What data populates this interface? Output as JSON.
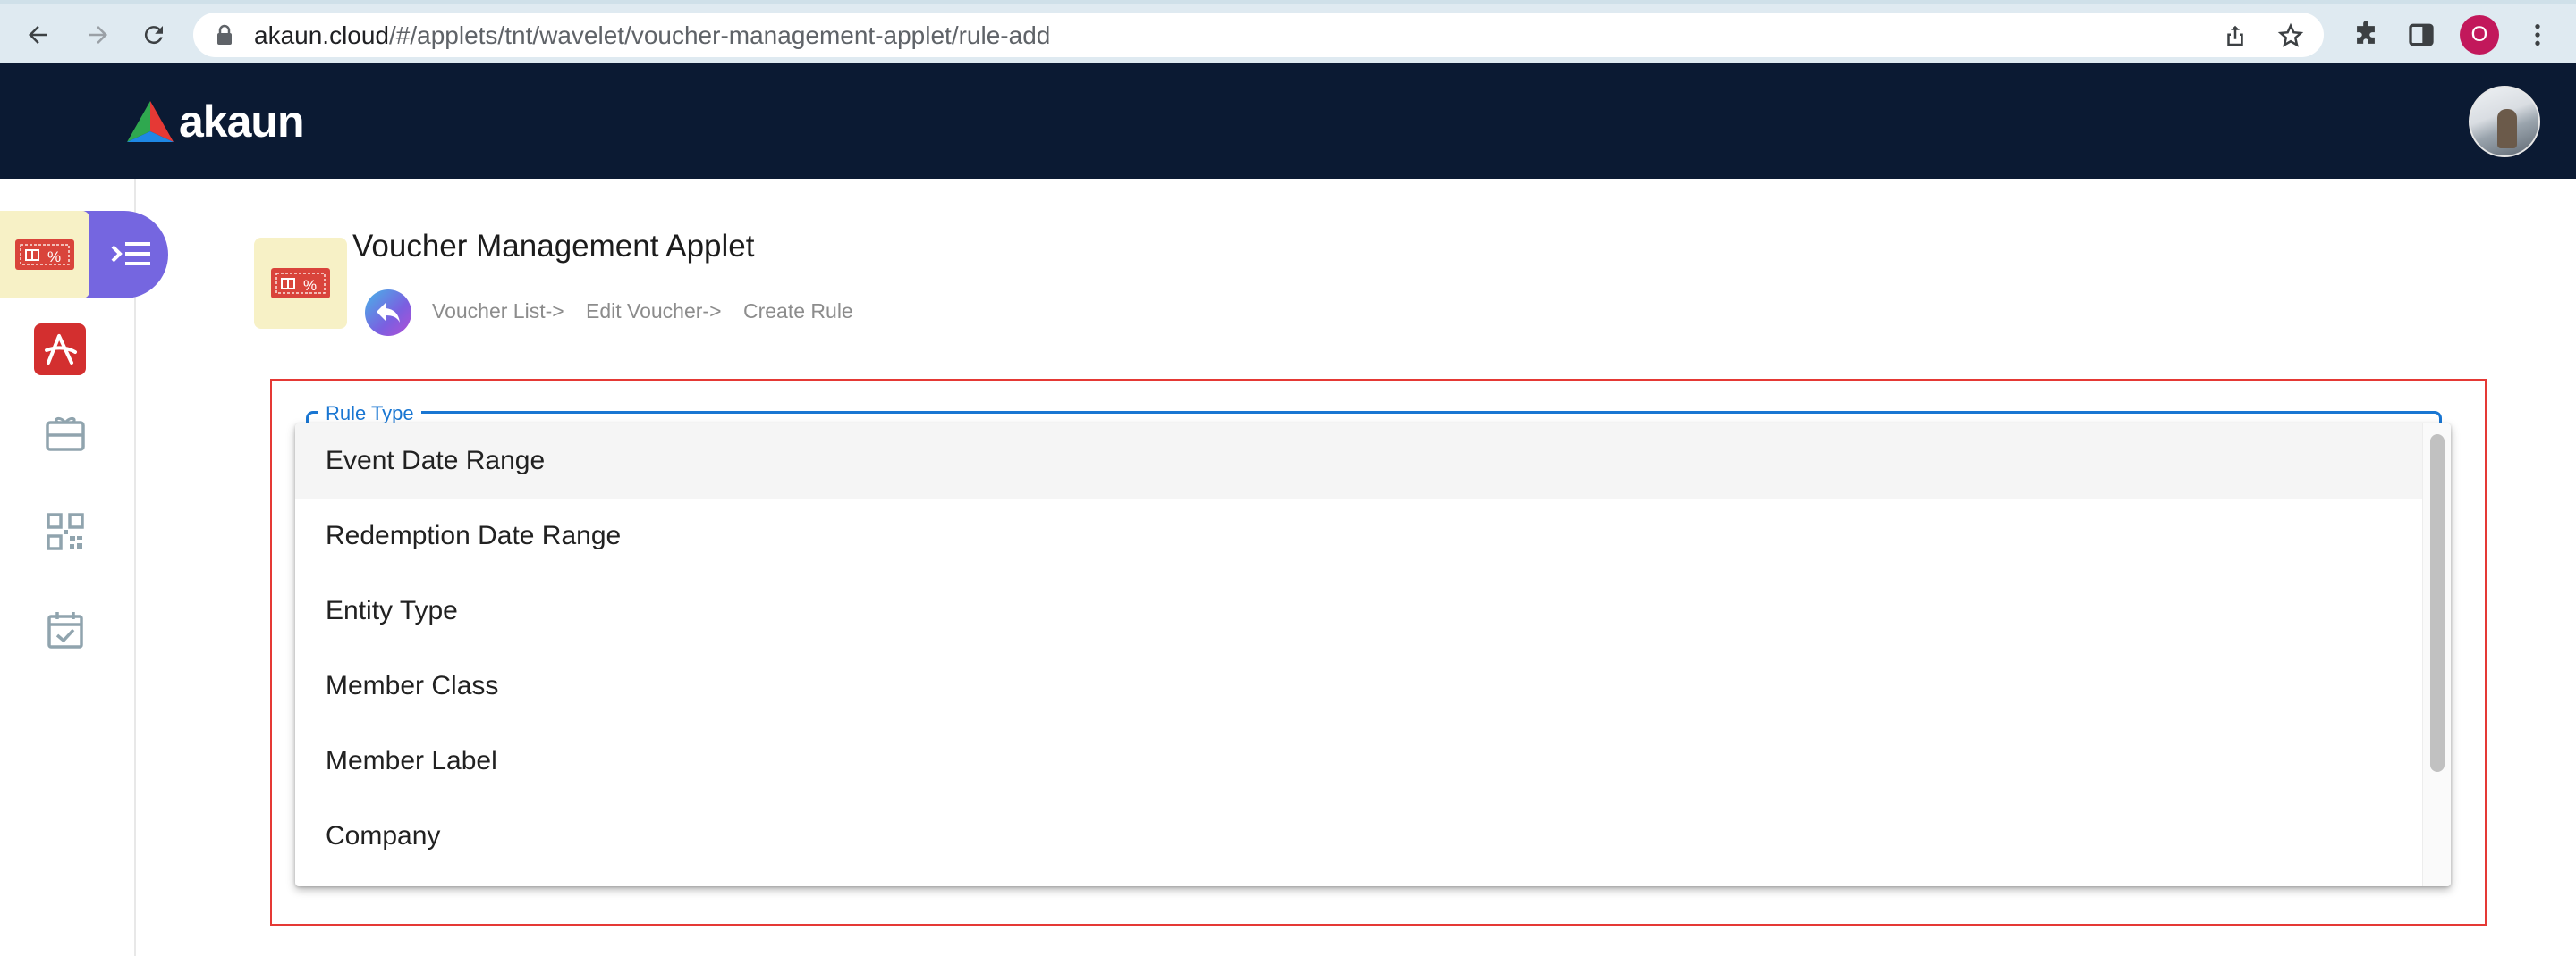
{
  "browser": {
    "url_host": "akaun.cloud",
    "url_path": "/#/applets/tnt/wavelet/voucher-management-applet/rule-add",
    "profile_initial": "O",
    "icons": [
      "back-arrow-icon",
      "forward-arrow-icon",
      "reload-icon",
      "lock-icon",
      "share-icon",
      "star-icon",
      "puzzle-icon",
      "side-panel-icon",
      "kebab-menu-icon"
    ]
  },
  "header": {
    "logo_text": "akaun",
    "background": "#0b1a33"
  },
  "sidebar": {
    "accent": "#7566e0",
    "items": [
      {
        "name": "voucher-icon",
        "active": true
      },
      {
        "name": "red-brand-icon",
        "active": false
      },
      {
        "name": "gift-card-icon",
        "active": false
      },
      {
        "name": "qr-code-icon",
        "active": false
      },
      {
        "name": "calendar-check-icon",
        "active": false
      }
    ]
  },
  "page": {
    "title": "Voucher Management Applet",
    "breadcrumbs": [
      "Voucher List->",
      "Edit Voucher->",
      "Create Rule"
    ]
  },
  "form": {
    "field_label": "Rule Type",
    "accent": "#1976d2",
    "frame_color": "#e53935",
    "options": [
      {
        "label": "Event Date Range",
        "highlighted": true
      },
      {
        "label": "Redemption Date Range",
        "highlighted": false
      },
      {
        "label": "Entity Type",
        "highlighted": false
      },
      {
        "label": "Member Class",
        "highlighted": false
      },
      {
        "label": "Member Label",
        "highlighted": false
      },
      {
        "label": "Company",
        "highlighted": false
      }
    ]
  }
}
